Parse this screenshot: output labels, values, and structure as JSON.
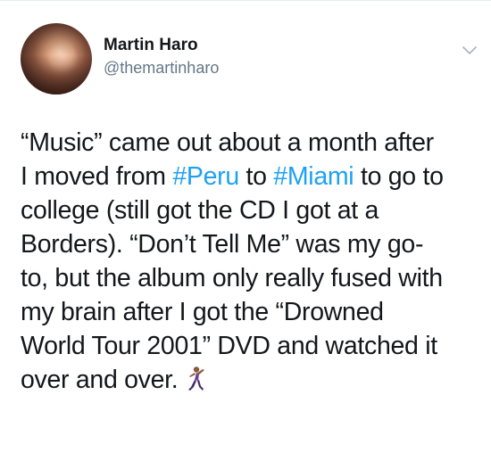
{
  "tweet": {
    "author": {
      "name": "Martin Haro",
      "handle": "@themartinharo"
    },
    "menu_icon": "chevron-down-icon",
    "lines": [
      {
        "segments": [
          {
            "text": "“Music” came out about a month after"
          }
        ]
      },
      {
        "segments": [
          {
            "text": "I moved from "
          },
          {
            "text": "#Peru",
            "hashtag": true
          },
          {
            "text": " to "
          },
          {
            "text": "#Miami",
            "hashtag": true
          },
          {
            "text": " to go to"
          }
        ]
      },
      {
        "segments": [
          {
            "text": "college (still got the CD I got at a"
          }
        ]
      },
      {
        "segments": [
          {
            "text": "Borders). “Don’t Tell Me” was my go-"
          }
        ]
      },
      {
        "segments": [
          {
            "text": "to, but the album only really fused with"
          }
        ]
      },
      {
        "segments": [
          {
            "text": "my brain after I got the “Drowned"
          }
        ]
      },
      {
        "segments": [
          {
            "text": "World Tour 2001” DVD and watched it"
          }
        ]
      },
      {
        "segments": [
          {
            "text": "over and over."
          }
        ],
        "emoji": "man-dancing-emoji"
      }
    ],
    "colors": {
      "text": "#14171a",
      "secondary": "#657786",
      "hashtag": "#1da1f2",
      "divider": "#e6ecf0"
    }
  }
}
